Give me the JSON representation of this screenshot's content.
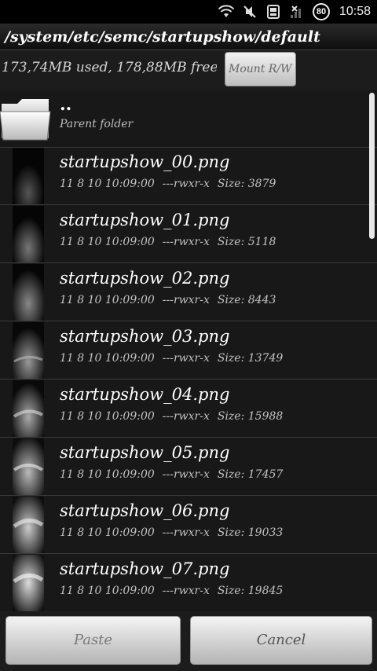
{
  "status_bar": {
    "battery": "80",
    "time": "10:58",
    "icons": [
      "wifi-icon",
      "mute-icon",
      "sd-card-icon",
      "no-signal-icon"
    ]
  },
  "path": "/system/etc/semc/startupshow/default",
  "storage": {
    "info": "173,74MB used, 178,88MB free, r/o",
    "mount_button": "Mount R/W"
  },
  "parent": {
    "name": "..",
    "label": "Parent folder"
  },
  "files": [
    {
      "name": "startupshow_00.png",
      "date": "11 8 10 10:09:00",
      "perms": "---rwxr-x",
      "size": "Size: 3879"
    },
    {
      "name": "startupshow_01.png",
      "date": "11 8 10 10:09:00",
      "perms": "---rwxr-x",
      "size": "Size: 5118"
    },
    {
      "name": "startupshow_02.png",
      "date": "11 8 10 10:09:00",
      "perms": "---rwxr-x",
      "size": "Size: 8443"
    },
    {
      "name": "startupshow_03.png",
      "date": "11 8 10 10:09:00",
      "perms": "---rwxr-x",
      "size": "Size: 13749"
    },
    {
      "name": "startupshow_04.png",
      "date": "11 8 10 10:09:00",
      "perms": "---rwxr-x",
      "size": "Size: 15988"
    },
    {
      "name": "startupshow_05.png",
      "date": "11 8 10 10:09:00",
      "perms": "---rwxr-x",
      "size": "Size: 17457"
    },
    {
      "name": "startupshow_06.png",
      "date": "11 8 10 10:09:00",
      "perms": "---rwxr-x",
      "size": "Size: 19033"
    },
    {
      "name": "startupshow_07.png",
      "date": "11 8 10 10:09:00",
      "perms": "---rwxr-x",
      "size": "Size: 19845"
    }
  ],
  "actions": {
    "paste": "Paste",
    "cancel": "Cancel"
  }
}
